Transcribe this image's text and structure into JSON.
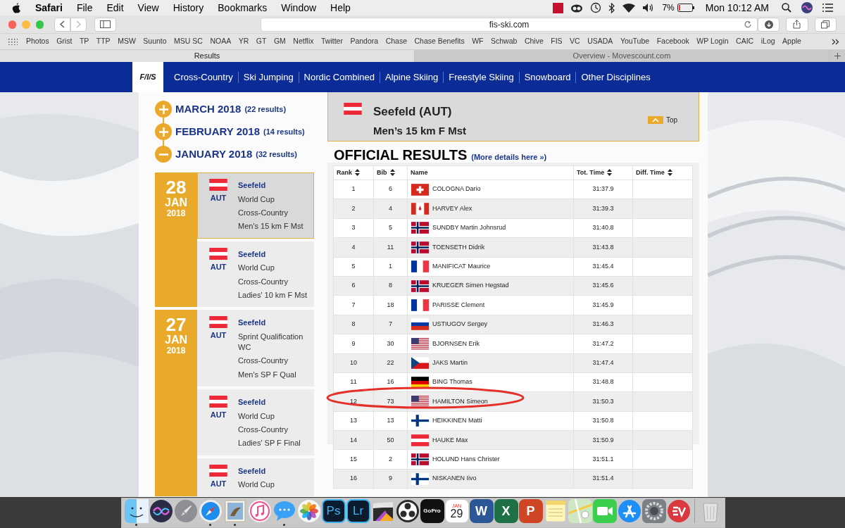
{
  "menu_bar": {
    "app": "Safari",
    "items": [
      "File",
      "Edit",
      "View",
      "History",
      "Bookmarks",
      "Window",
      "Help"
    ],
    "battery": "7%",
    "clock": "Mon 10:12 AM"
  },
  "browser": {
    "url": "fis-ski.com",
    "bookmarks": [
      "Photos",
      "Grist",
      "TP",
      "TTP",
      "MSW",
      "Suunto",
      "MSU SC",
      "NOAA",
      "YR",
      "GT",
      "GM",
      "Netflix",
      "Twitter",
      "Pandora",
      "Chase",
      "Chase Benefits",
      "WF",
      "Schwab",
      "Chive",
      "FIS",
      "VC",
      "USADA",
      "YouTube",
      "Facebook",
      "WP Login",
      "CAIC",
      "iLog",
      "Apple"
    ],
    "tabs": [
      {
        "label": "Results",
        "selected": true
      },
      {
        "label": "Overview - Movescount.com",
        "selected": false
      }
    ]
  },
  "site": {
    "logo": "F/I/S",
    "nav": [
      "Cross-Country",
      "Ski Jumping",
      "Nordic Combined",
      "Alpine Skiing",
      "Freestyle Skiing",
      "Snowboard",
      "Other Disciplines"
    ]
  },
  "calendar": {
    "months": [
      {
        "label": "MARCH 2018",
        "count": "(22 results)",
        "expanded": false
      },
      {
        "label": "FEBRUARY 2018",
        "count": "(14 results)",
        "expanded": false
      },
      {
        "label": "JANUARY 2018",
        "count": "(32 results)",
        "expanded": true
      }
    ],
    "days": [
      {
        "day": "28",
        "month": "JAN",
        "year": "2018",
        "events": [
          {
            "place": "Seefeld",
            "country": "AUT",
            "lines": [
              "World Cup",
              "Cross-Country",
              "Men's 15 km F Mst"
            ],
            "selected": true
          },
          {
            "place": "Seefeld",
            "country": "AUT",
            "lines": [
              "World Cup",
              "Cross-Country",
              "Ladies' 10 km F Mst"
            ],
            "selected": false
          }
        ]
      },
      {
        "day": "27",
        "month": "JAN",
        "year": "2018",
        "events": [
          {
            "place": "Seefeld",
            "country": "AUT",
            "lines": [
              "Sprint Qualification WC",
              "Cross-Country",
              "Men's SP F Qual"
            ],
            "selected": false
          },
          {
            "place": "Seefeld",
            "country": "AUT",
            "lines": [
              "World Cup",
              "Cross-Country",
              "Ladies' SP F Final"
            ],
            "selected": false
          },
          {
            "place": "Seefeld",
            "country": "AUT",
            "lines": [
              "World Cup"
            ],
            "selected": false
          }
        ]
      }
    ]
  },
  "race": {
    "title": "Seefeld (AUT)",
    "subtitle": "Men’s 15 km F Mst",
    "top_link": "Top",
    "heading": "OFFICIAL RESULTS",
    "details_link": "(More details here »)"
  },
  "results": {
    "columns": [
      {
        "label": "Rank",
        "sortable": true
      },
      {
        "label": "Bib",
        "sortable": true
      },
      {
        "label": "Name",
        "sortable": false
      },
      {
        "label": "Tot. Time",
        "sortable": true
      },
      {
        "label": "Diff. Time",
        "sortable": true
      }
    ],
    "rows": [
      {
        "rank": "1",
        "bib": "6",
        "kind": "sui",
        "name": "COLOGNA Dario",
        "time": "31:37.9"
      },
      {
        "rank": "2",
        "bib": "4",
        "kind": "can",
        "name": "HARVEY Alex",
        "time": "31:39.3"
      },
      {
        "rank": "3",
        "bib": "5",
        "kind": "nor",
        "name": "SUNDBY Martin Johnsrud",
        "time": "31:40.8"
      },
      {
        "rank": "4",
        "bib": "11",
        "kind": "nor",
        "name": "TOENSETH Didrik",
        "time": "31:43.8"
      },
      {
        "rank": "5",
        "bib": "1",
        "kind": "fra",
        "name": "MANIFICAT Maurice",
        "time": "31:45.4"
      },
      {
        "rank": "6",
        "bib": "8",
        "kind": "nor",
        "name": "KRUEGER Simen Hegstad",
        "time": "31:45.6"
      },
      {
        "rank": "7",
        "bib": "18",
        "kind": "fra",
        "name": "PARISSE Clement",
        "time": "31:45.9"
      },
      {
        "rank": "8",
        "bib": "7",
        "kind": "rus",
        "name": "USTIUGOV Sergey",
        "time": "31:46.3"
      },
      {
        "rank": "9",
        "bib": "30",
        "kind": "usa",
        "name": "BJORNSEN Erik",
        "time": "31:47.2"
      },
      {
        "rank": "10",
        "bib": "22",
        "kind": "cze",
        "name": "JAKS Martin",
        "time": "31:47.4"
      },
      {
        "rank": "11",
        "bib": "16",
        "kind": "ger",
        "name": "BING Thomas",
        "time": "31:48.8"
      },
      {
        "rank": "12",
        "bib": "73",
        "kind": "usa",
        "name": "HAMILTON Simeon",
        "time": "31:50.3"
      },
      {
        "rank": "13",
        "bib": "13",
        "kind": "fin",
        "name": "HEIKKINEN Matti",
        "time": "31:50.8"
      },
      {
        "rank": "14",
        "bib": "50",
        "kind": "aut",
        "name": "HAUKE Max",
        "time": "31:50.9"
      },
      {
        "rank": "15",
        "bib": "2",
        "kind": "nor",
        "name": "HOLUND Hans Christer",
        "time": "31:51.1"
      },
      {
        "rank": "16",
        "bib": "9",
        "kind": "fin",
        "name": "NISKANEN Iivo",
        "time": "31:51.4"
      }
    ]
  },
  "dock": [
    {
      "kind": "finder",
      "running": true
    },
    {
      "kind": "siri",
      "running": false
    },
    {
      "kind": "launchpad",
      "running": false
    },
    {
      "kind": "safari",
      "running": true
    },
    {
      "kind": "preview",
      "running": true
    },
    {
      "kind": "music",
      "running": false
    },
    {
      "kind": "messages",
      "running": true
    },
    {
      "kind": "photos",
      "running": false
    },
    {
      "kind": "adobe",
      "label": "Ps",
      "running": false
    },
    {
      "kind": "adobe",
      "label": "Lr",
      "running": false
    },
    {
      "kind": "clapper",
      "running": false
    },
    {
      "kind": "obs",
      "running": false
    },
    {
      "kind": "camera",
      "label": "GoPro",
      "running": false
    },
    {
      "kind": "calendar",
      "label": "29",
      "sublabel": "JAN",
      "running": false
    },
    {
      "kind": "office",
      "label": "W",
      "color": "#2b5797",
      "running": false
    },
    {
      "kind": "office",
      "label": "X",
      "color": "#1e7145",
      "running": false
    },
    {
      "kind": "office",
      "label": "P",
      "color": "#d04525",
      "running": false
    },
    {
      "kind": "notes",
      "running": false
    },
    {
      "kind": "maps",
      "running": false
    },
    {
      "kind": "facetime",
      "running": false
    },
    {
      "kind": "appstore",
      "running": false
    },
    {
      "kind": "settings",
      "running": false
    },
    {
      "kind": "vpn",
      "running": false
    },
    {
      "kind": "trash",
      "running": false
    }
  ]
}
